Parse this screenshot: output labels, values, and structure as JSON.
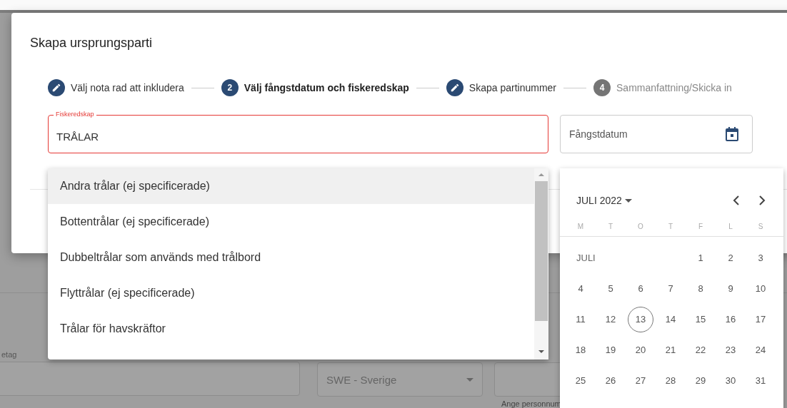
{
  "background_form": {
    "company_label": "etag",
    "country_select": "SWE - Sverige",
    "helper_text": "Ange personnum"
  },
  "dialog": {
    "title": "Skapa ursprungsparti",
    "steps": [
      {
        "kind": "edit",
        "label": "Välj nota rad att inkludera",
        "selected": false,
        "disabled": false
      },
      {
        "kind": "number",
        "number": "2",
        "label": "Välj fångstdatum och fiskeredskap",
        "selected": true,
        "disabled": false
      },
      {
        "kind": "edit",
        "label": "Skapa partinummer",
        "selected": false,
        "disabled": false
      },
      {
        "kind": "number",
        "number": "4",
        "label": "Sammanfattning/Skicka in",
        "selected": false,
        "disabled": true
      }
    ],
    "gear_field": {
      "label": "Fiskeredskap",
      "value": "TRÅLAR",
      "error": true
    },
    "date_field": {
      "placeholder": "Fångstdatum"
    }
  },
  "gear_dropdown": {
    "options": [
      {
        "label": "Andra trålar (ej specificerade)",
        "selected": true
      },
      {
        "label": "Bottentrålar (ej specificerade)",
        "selected": false
      },
      {
        "label": "Dubbeltrålar som används med trålbord",
        "selected": false
      },
      {
        "label": "Flyttrålar (ej specificerade)",
        "selected": false
      },
      {
        "label": "Trålar för havskräftor",
        "selected": false
      }
    ]
  },
  "calendar": {
    "month_year": "JULI 2022",
    "weekdays": [
      "M",
      "T",
      "O",
      "T",
      "F",
      "L",
      "S"
    ],
    "month_name": "JULI",
    "weeks": [
      [
        {
          "day": "1",
          "today": false
        },
        {
          "day": "2",
          "today": false
        },
        {
          "day": "3",
          "today": false
        }
      ],
      [
        {
          "day": "4",
          "today": false
        },
        {
          "day": "5",
          "today": false
        },
        {
          "day": "6",
          "today": false
        },
        {
          "day": "7",
          "today": false
        },
        {
          "day": "8",
          "today": false
        },
        {
          "day": "9",
          "today": false
        },
        {
          "day": "10",
          "today": false
        }
      ],
      [
        {
          "day": "11",
          "today": false
        },
        {
          "day": "12",
          "today": false
        },
        {
          "day": "13",
          "today": true
        },
        {
          "day": "14",
          "today": false
        },
        {
          "day": "15",
          "today": false
        },
        {
          "day": "16",
          "today": false
        },
        {
          "day": "17",
          "today": false
        }
      ],
      [
        {
          "day": "18",
          "today": false
        },
        {
          "day": "19",
          "today": false
        },
        {
          "day": "20",
          "today": false
        },
        {
          "day": "21",
          "today": false
        },
        {
          "day": "22",
          "today": false
        },
        {
          "day": "23",
          "today": false
        },
        {
          "day": "24",
          "today": false
        }
      ],
      [
        {
          "day": "25",
          "today": false
        },
        {
          "day": "26",
          "today": false
        },
        {
          "day": "27",
          "today": false
        },
        {
          "day": "28",
          "today": false
        },
        {
          "day": "29",
          "today": false
        },
        {
          "day": "30",
          "today": false
        },
        {
          "day": "31",
          "today": false
        }
      ]
    ]
  }
}
